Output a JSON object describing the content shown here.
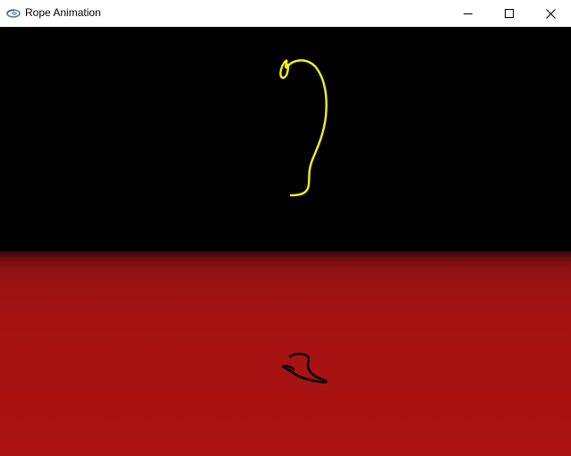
{
  "window": {
    "title": "Rope Animation",
    "app_icon": "opengl-app-icon",
    "controls": {
      "minimize_icon": "minimize-icon",
      "maximize_icon": "maximize-icon",
      "close_icon": "close-icon"
    }
  },
  "scene": {
    "background_color": "#000000",
    "floor_color": "#aa1312",
    "rope_color": "#f5f020",
    "shadow_color": "#000000"
  }
}
